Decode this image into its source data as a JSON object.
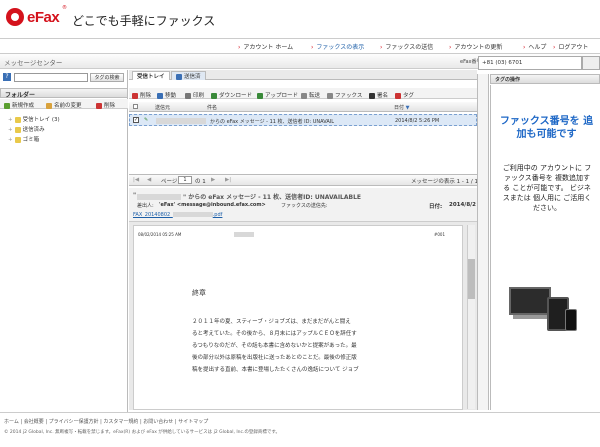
{
  "brand": {
    "logo": "eFax",
    "registered": "®",
    "tagline": "どこでも手軽にファックス",
    "color": "#d4121c"
  },
  "nav": {
    "items": [
      {
        "label": "アカウント ホーム",
        "active": false
      },
      {
        "label": "ファックスの表示",
        "active": true
      },
      {
        "label": "ファックスの送信",
        "active": false
      },
      {
        "label": "アカウントの更新",
        "active": false
      },
      {
        "label": "ヘルプ",
        "active": false
      },
      {
        "label": "ログアウト",
        "active": false
      }
    ]
  },
  "titlebar": {
    "title": "メッセージセンター",
    "efax_number_label": "eFax番号:",
    "efax_number": "+81 (03) 6701"
  },
  "left": {
    "search_button": "タグの検索",
    "folders_header": "フォルダー",
    "toolbar": {
      "new_folder": "新規作成",
      "rename": "名前の変更",
      "delete": "削除"
    },
    "folders": [
      {
        "label": "受信トレイ (3)"
      },
      {
        "label": "送信済み"
      },
      {
        "label": "ゴミ箱"
      }
    ]
  },
  "tabs": {
    "inbox": "受信トレイ",
    "sent": "送信済"
  },
  "toolbar": {
    "delete": "削除",
    "move": "移動",
    "print": "印刷",
    "download": "ダウンロード",
    "upload": "アップロード",
    "forward": "転送",
    "fax": "ファックス",
    "sign": "署名",
    "tag": "タグ"
  },
  "columns": {
    "from": "送信元",
    "title": "件名",
    "date": "日付"
  },
  "message_row": {
    "subject": "からの eFax メッセージ - 11 枚、送信者 ID: UNAVAIL",
    "date": "2014/8/2 5:26 PM"
  },
  "pager": {
    "page_label": "ページ",
    "page_value": "1",
    "of_label": "の 1",
    "summary": "メッセージの表示 1 - 1 / 1"
  },
  "detail": {
    "subject_lead": "\"",
    "subject_rest": "\" からの eFax メッセージ - 11 枚、送信者ID: UNAVAILABLE",
    "sender_label": "差出人:",
    "sender": "'eFax' <message@inbound.efax.com>",
    "recipient_label": "ファックスの送信先:",
    "date_label": "日付:",
    "date": "2014/8/2",
    "attachment_prefix": "FAX_20140802_",
    "attachment_suffix": ".pdf"
  },
  "fax_doc": {
    "header_date": "08/02/2014 05:25 AM",
    "header_page": "#001",
    "title": "終章",
    "lines": [
      "２０１１年の夏、スティーブ・ジョブズは、まだまだがんと闘え",
      "ると考えていた。その後から、８月末にはアップルＣＥＯを辞任す",
      "るつもりなのだが、その話も本書に含めないかと提案があった。最",
      "後の部分以外は原稿を出版社に送ったあとのことだ。最後の修正版",
      "稿を提出する直前、本書に登場したたくさんの逸話について ジョブ"
    ]
  },
  "right": {
    "header": "タグの操作",
    "ad_title": "ファックス番号を 追加も可能です",
    "ad_body": "ご利用中の アカウントに ファックス番号を 複数追加する ことが可能です。 ビジネスまたは 個人用に ご活用ください。"
  },
  "footer": {
    "links": [
      "ホーム",
      "会社概要",
      "プライバシー保護方針",
      "カスタマー規約",
      "お問い合わせ",
      "サイトマップ"
    ],
    "copyright": "© 2014 j2 Global, Inc. 無断複写・転載を禁じます。eFax(R) および eFax が供給しているサービスは j2 Global, Inc.の登録商標です。"
  }
}
